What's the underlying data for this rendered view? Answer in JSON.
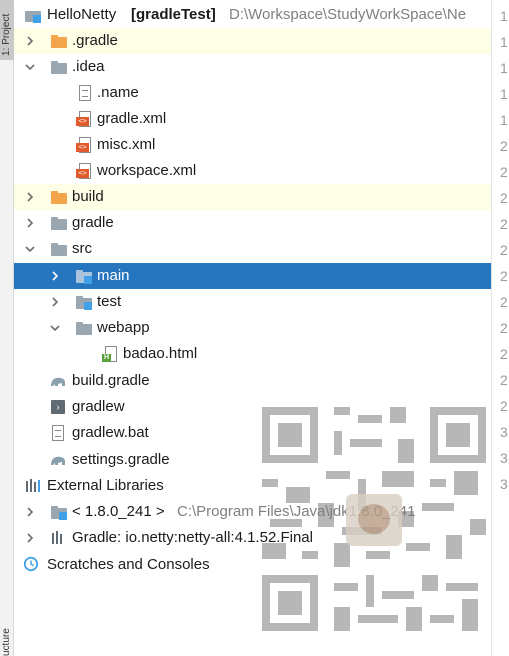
{
  "side_tab": {
    "top_label": "1: Project",
    "bottom_label": "ucture"
  },
  "project": {
    "root_name": "HelloNetty",
    "root_module": "[gradleTest]",
    "root_path": "D:\\Workspace\\StudyWorkSpace\\Ne",
    "folder_gradle_hidden": ".gradle",
    "folder_idea": ".idea",
    "file_name": ".name",
    "file_gradle_xml": "gradle.xml",
    "file_misc_xml": "misc.xml",
    "file_workspace_xml": "workspace.xml",
    "folder_build": "build",
    "folder_gradle": "gradle",
    "folder_src": "src",
    "folder_main": "main",
    "folder_test": "test",
    "folder_webapp": "webapp",
    "file_badao_html": "badao.html",
    "file_build_gradle": "build.gradle",
    "file_gradlew": "gradlew",
    "file_gradlew_bat": "gradlew.bat",
    "file_settings_gradle": "settings.gradle"
  },
  "external": {
    "label": "External Libraries",
    "jdk_label": "< 1.8.0_241 >",
    "jdk_path": "C:\\Program Files\\Java\\jdk1.8.0_241",
    "gradle_lib": "Gradle: io.netty:netty-all:4.1.52.Final"
  },
  "scratches": {
    "label": "Scratches and Consoles"
  },
  "gutter_numbers": [
    "1",
    "1",
    "1",
    "1",
    "1",
    "2",
    "2",
    "2",
    "2",
    "2",
    "2",
    "2",
    "2",
    "2",
    "2",
    "2",
    "3",
    "3",
    "3"
  ],
  "icons": {
    "arrow_right": "chevron-right-icon",
    "arrow_down": "chevron-down-icon",
    "folder": "folder-icon",
    "module": "module-icon",
    "xml": "xml-file-icon",
    "text": "text-file-icon",
    "html": "html-file-icon",
    "gradle": "gradle-icon",
    "terminal": "terminal-icon",
    "libraries": "libraries-icon",
    "scratches": "scratches-icon"
  },
  "colors": {
    "selection": "#2675bf",
    "highlight_row": "#fefde6",
    "folder_grey": "#9aa7b0",
    "folder_orange": "#f2a54a",
    "xml_badge": "#e05a2b"
  }
}
